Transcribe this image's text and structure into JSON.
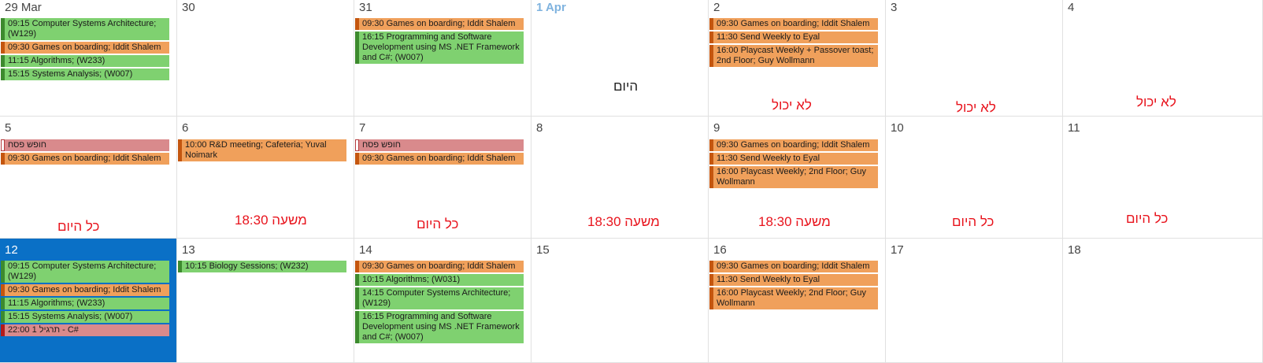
{
  "colors": {
    "today_background": "#0a70c6",
    "green_event": "#7fd170",
    "orange_event": "#f0a05b",
    "pink_event": "#d98a8c",
    "note_red": "#e8131c"
  },
  "weeks": [
    {
      "days": [
        {
          "label": "29 Mar",
          "events": [
            {
              "text": "09:15 Computer Systems Architecture; (W129)",
              "color": "green"
            },
            {
              "text": "09:30 Games on boarding; Iddit Shalem",
              "color": "orange"
            },
            {
              "text": "11:15 Algorithms; (W233)",
              "color": "green"
            },
            {
              "text": "15:15 Systems Analysis; (W007)",
              "color": "green"
            }
          ]
        },
        {
          "label": "30",
          "events": []
        },
        {
          "label": "31",
          "events": [
            {
              "text": "09:30 Games on boarding; Iddit Shalem",
              "color": "orange"
            },
            {
              "text": "16:15 Programming and Software Development using MS .NET Framework and C#; (W007)",
              "color": "green"
            }
          ]
        },
        {
          "label": "1 Apr",
          "events": [],
          "note": "היום"
        },
        {
          "label": "2",
          "events": [
            {
              "text": "09:30 Games on boarding; Iddit Shalem",
              "color": "orange"
            },
            {
              "text": "11:30 Send Weekly to Eyal",
              "color": "orange"
            },
            {
              "text": "16:00 Playcast Weekly + Passover toast; 2nd Floor; Guy Wollmann",
              "color": "orange"
            }
          ],
          "note": "לא יכול"
        },
        {
          "label": "3",
          "events": [],
          "note": "לא יכול"
        },
        {
          "label": "4",
          "events": [],
          "note": "לא יכול"
        }
      ]
    },
    {
      "days": [
        {
          "label": "5",
          "events": [
            {
              "text": "חופש פסח",
              "color": "pink"
            },
            {
              "text": "09:30 Games on boarding; Iddit Shalem",
              "color": "orange"
            }
          ],
          "note": "כל היום"
        },
        {
          "label": "6",
          "events": [
            {
              "text": "10:00 R&D meeting; Cafeteria; Yuval Noimark",
              "color": "orange"
            }
          ],
          "note": "משעה 18:30"
        },
        {
          "label": "7",
          "events": [
            {
              "text": "חופש פסח",
              "color": "pink"
            },
            {
              "text": "09:30 Games on boarding; Iddit Shalem",
              "color": "orange"
            }
          ],
          "note": "כל היום"
        },
        {
          "label": "8",
          "events": [],
          "note": "משעה 18:30"
        },
        {
          "label": "9",
          "events": [
            {
              "text": "09:30 Games on boarding; Iddit Shalem",
              "color": "orange"
            },
            {
              "text": "11:30 Send Weekly to Eyal",
              "color": "orange"
            },
            {
              "text": "16:00 Playcast Weekly; 2nd Floor; Guy Wollmann",
              "color": "orange"
            }
          ],
          "note": "משעה 18:30"
        },
        {
          "label": "10",
          "events": [],
          "note": "כל היום"
        },
        {
          "label": "11",
          "events": [],
          "note": "כל היום"
        }
      ]
    },
    {
      "days": [
        {
          "label": "12",
          "events": [
            {
              "text": "09:15 Computer Systems Architecture; (W129)",
              "color": "green"
            },
            {
              "text": "09:30 Games on boarding; Iddit Shalem",
              "color": "orange"
            },
            {
              "text": "11:15 Algorithms; (W233)",
              "color": "green"
            },
            {
              "text": "15:15 Systems Analysis; (W007)",
              "color": "green"
            },
            {
              "text": "22:00 תרגיל 1 - C#",
              "color": "red"
            }
          ]
        },
        {
          "label": "13",
          "events": [
            {
              "text": "10:15 Biology Sessions; (W232)",
              "color": "green"
            }
          ]
        },
        {
          "label": "14",
          "events": [
            {
              "text": "09:30 Games on boarding; Iddit Shalem",
              "color": "orange"
            },
            {
              "text": "10:15 Algorithms; (W031)",
              "color": "green"
            },
            {
              "text": "14:15 Computer Systems Architecture; (W129)",
              "color": "green"
            },
            {
              "text": "16:15 Programming and Software Development using MS .NET Framework and C#; (W007)",
              "color": "green"
            }
          ]
        },
        {
          "label": "15",
          "events": []
        },
        {
          "label": "16",
          "events": [
            {
              "text": "09:30 Games on boarding; Iddit Shalem",
              "color": "orange"
            },
            {
              "text": "11:30 Send Weekly to Eyal",
              "color": "orange"
            },
            {
              "text": "16:00 Playcast Weekly; 2nd Floor; Guy Wollmann",
              "color": "orange"
            }
          ]
        },
        {
          "label": "17",
          "events": []
        },
        {
          "label": "18",
          "events": []
        }
      ]
    }
  ]
}
